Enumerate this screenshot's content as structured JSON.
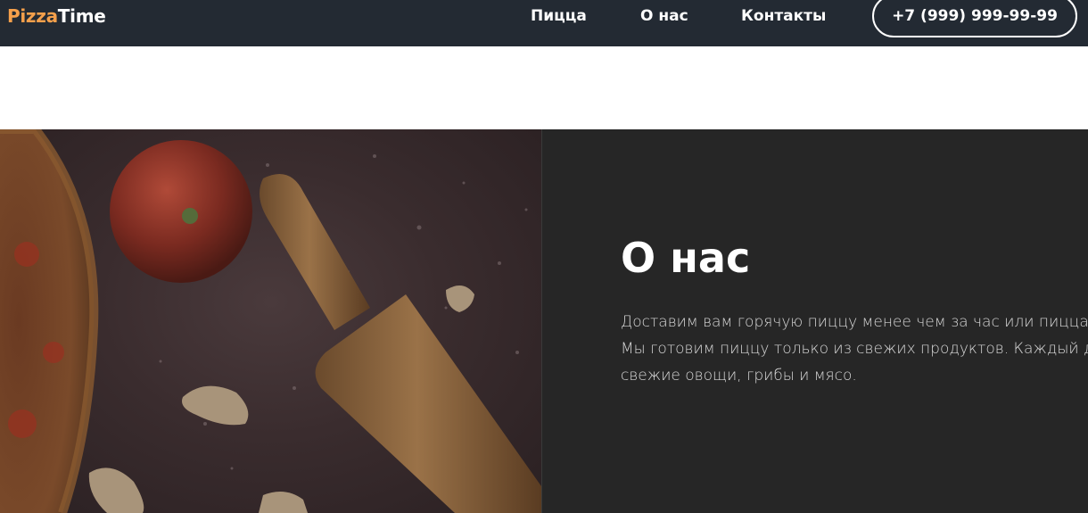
{
  "header": {
    "logo_accent": "Pizza",
    "logo_rest": "Time",
    "nav": [
      {
        "label": "Пицца"
      },
      {
        "label": "О нас"
      },
      {
        "label": "Контакты"
      }
    ],
    "phone": "+7 (999) 999-99-99"
  },
  "about": {
    "title": "О нас",
    "lines": [
      "Доставим вам горячую пиццу менее чем за час или пицца бесп",
      "Мы готовим пиццу только из свежих продуктов. Каждый день м",
      "свежие овощи, грибы и мясо."
    ]
  },
  "colors": {
    "header_bg": "#232a33",
    "logo_accent": "#f5a04b",
    "section_bg": "#262626"
  },
  "icons": [
    "pizza-photo"
  ]
}
